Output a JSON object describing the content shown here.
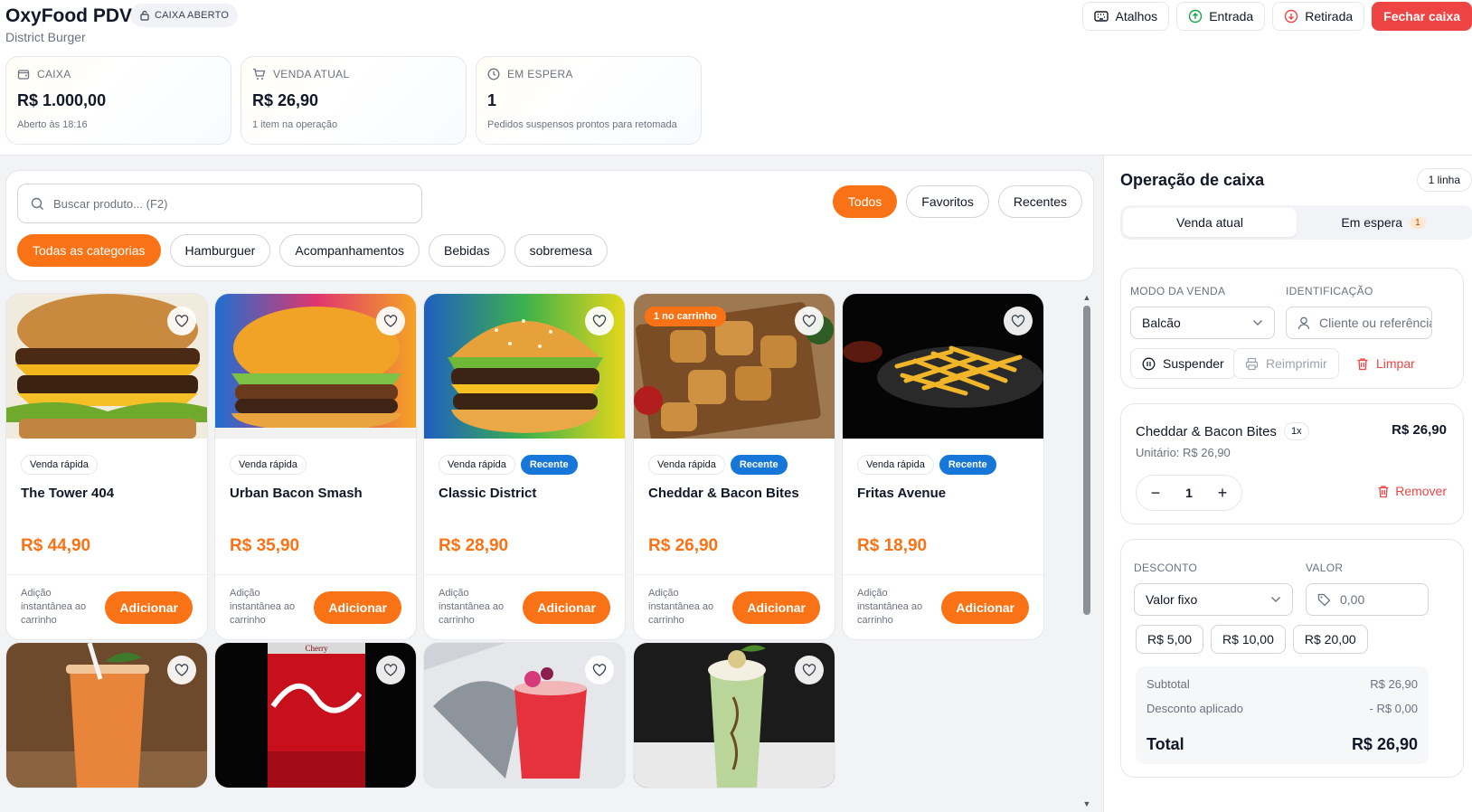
{
  "header": {
    "title": "OxyFood PDV",
    "status": "CAIXA ABERTO",
    "subtitle": "District Burger",
    "buttons": {
      "atalhos": "Atalhos",
      "entrada": "Entrada",
      "retirada": "Retirada",
      "fechar": "Fechar caixa"
    }
  },
  "stats": [
    {
      "label": "CAIXA",
      "value": "R$ 1.000,00",
      "note": "Aberto às 18:16",
      "icon": "wallet-icon"
    },
    {
      "label": "VENDA ATUAL",
      "value": "R$ 26,90",
      "note": "1 item na operação",
      "icon": "cart-icon"
    },
    {
      "label": "EM ESPERA",
      "value": "1",
      "note": "Pedidos suspensos prontos para retomada",
      "icon": "clock-icon"
    }
  ],
  "search": {
    "placeholder": "Buscar produto... (F2)",
    "value": ""
  },
  "view_filters": [
    "Todos",
    "Favoritos",
    "Recentes"
  ],
  "active_view": "Todos",
  "categories": [
    "Todas as categorias",
    "Hamburguer",
    "Acompanhamentos",
    "Bebidas",
    "sobremesa"
  ],
  "active_category": "Todas as categorias",
  "product_common": {
    "badge_quick": "Venda rápida",
    "badge_recent": "Recente",
    "in_cart_label": "1 no carrinho",
    "footer_note": "Adição instantânea ao carrinho",
    "add_label": "Adicionar"
  },
  "products": [
    {
      "name": "The Tower 404",
      "price": "R$ 44,90",
      "recent": false,
      "in_cart": false,
      "image": "burger"
    },
    {
      "name": "Urban Bacon Smash",
      "price": "R$ 35,90",
      "recent": false,
      "in_cart": false,
      "image": "burger"
    },
    {
      "name": "Classic District",
      "price": "R$ 28,90",
      "recent": true,
      "in_cart": false,
      "image": "burger"
    },
    {
      "name": "Cheddar & Bacon Bites",
      "price": "R$ 26,90",
      "recent": true,
      "in_cart": true,
      "image": "bites"
    },
    {
      "name": "Fritas Avenue",
      "price": "R$ 18,90",
      "recent": true,
      "in_cart": false,
      "image": "fries"
    },
    {
      "name": "",
      "price": "",
      "recent": false,
      "in_cart": false,
      "image": "juice"
    },
    {
      "name": "",
      "price": "",
      "recent": false,
      "in_cart": false,
      "image": "cola"
    },
    {
      "name": "",
      "price": "",
      "recent": false,
      "in_cart": false,
      "image": "red-drink"
    },
    {
      "name": "",
      "price": "",
      "recent": false,
      "in_cart": false,
      "image": "milkshake"
    }
  ],
  "cola_can_text": "Cherry",
  "side": {
    "title": "Operação de caixa",
    "lines_badge": "1 linha",
    "tabs": {
      "current": "Venda atual",
      "waiting": "Em espera",
      "waiting_count": "1"
    },
    "mode_label": "MODO DA VENDA",
    "mode_value": "Balcão",
    "id_label": "IDENTIFICAÇÃO",
    "id_placeholder": "Cliente ou referência",
    "suspend": "Suspender",
    "reprint": "Reimprimir",
    "clear": "Limpar"
  },
  "cart_item": {
    "name": "Cheddar & Bacon Bites",
    "qty_badge": "1x",
    "total": "R$ 26,90",
    "unit": "Unitário: R$ 26,90",
    "qty": "1",
    "remove": "Remover"
  },
  "discount": {
    "label": "DESCONTO",
    "type": "Valor fixo",
    "value_label": "VALOR",
    "value_placeholder": "0,00",
    "quick": [
      "R$ 5,00",
      "R$ 10,00",
      "R$ 20,00"
    ]
  },
  "summary": {
    "subtotal_label": "Subtotal",
    "subtotal": "R$ 26,90",
    "discount_label": "Desconto aplicado",
    "discount": "- R$ 0,00",
    "total_label": "Total",
    "total": "R$ 26,90"
  },
  "colors": {
    "accent": "#f97316",
    "danger": "#ef4444",
    "recent": "#1677d8",
    "success": "#16a34a"
  }
}
